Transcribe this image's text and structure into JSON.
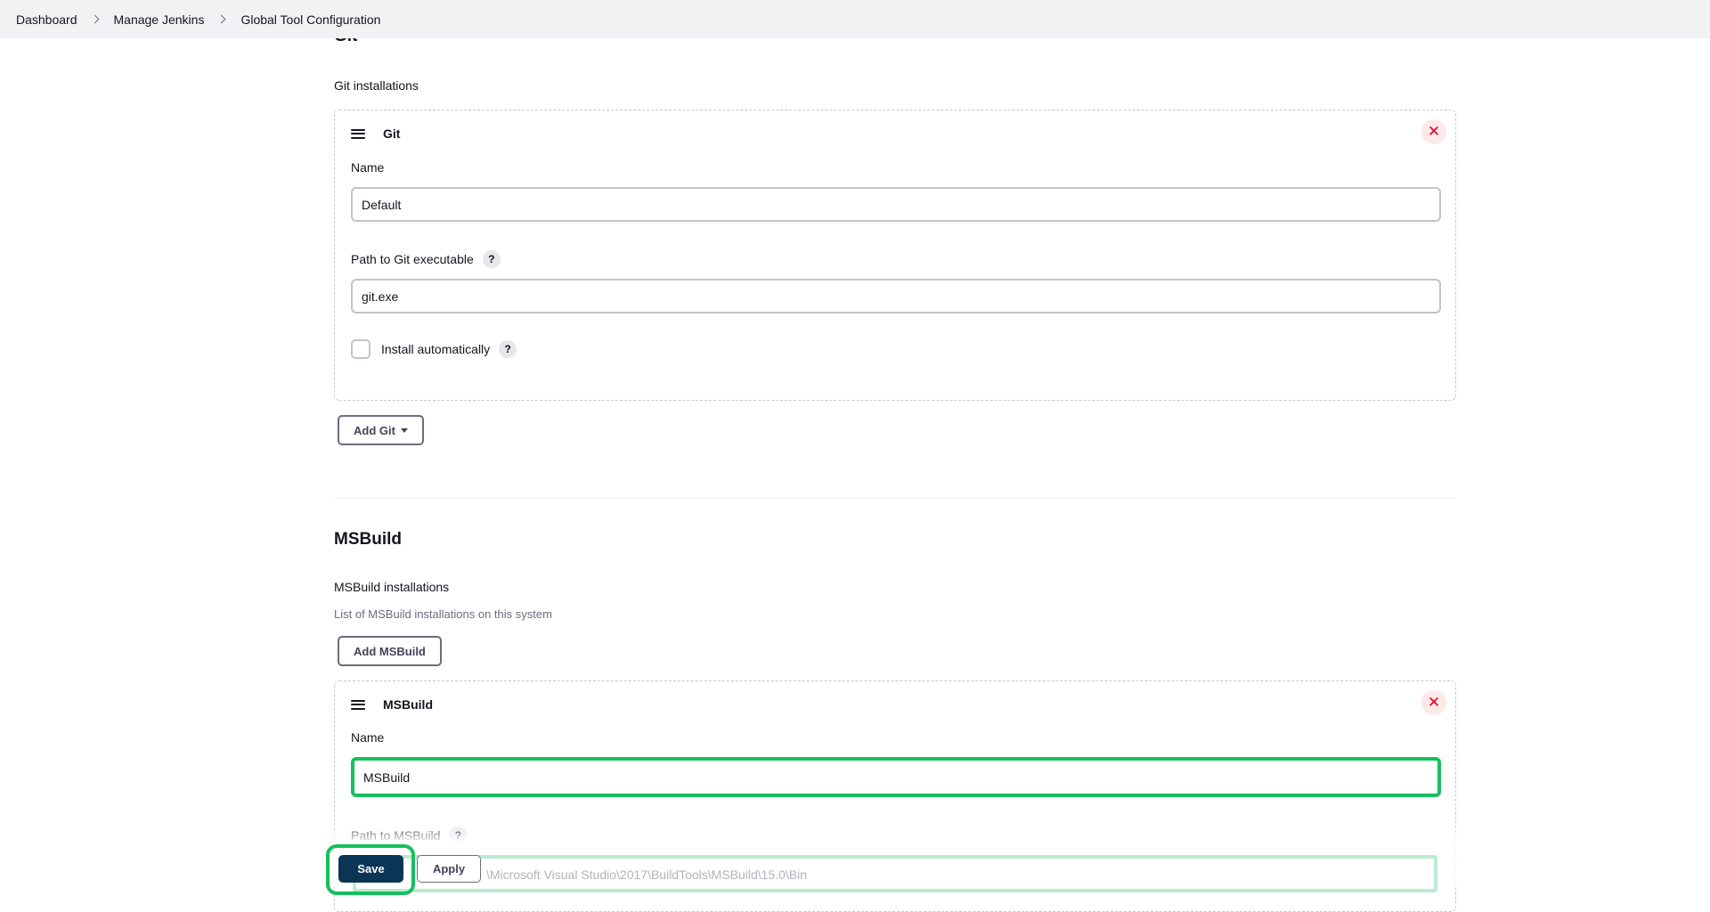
{
  "breadcrumb": {
    "items": [
      "Dashboard",
      "Manage Jenkins",
      "Global Tool Configuration"
    ]
  },
  "git": {
    "section_title": "Git",
    "installations_label": "Git installations",
    "item": {
      "title": "Git",
      "name_label": "Name",
      "name_value": "Default",
      "path_label": "Path to Git executable",
      "path_value": "git.exe",
      "install_auto_label": "Install automatically",
      "install_auto_checked": false
    },
    "add_button_label": "Add Git"
  },
  "msbuild": {
    "section_title": "MSBuild",
    "installations_label": "MSBuild installations",
    "description": "List of MSBuild installations on this system",
    "add_button_label": "Add MSBuild",
    "item": {
      "title": "MSBuild",
      "name_label": "Name",
      "name_value": "MSBuild",
      "path_label": "Path to MSBuild",
      "path_value": "\\Microsoft Visual Studio\\2017\\BuildTools\\MSBuild\\15.0\\Bin"
    }
  },
  "actions": {
    "save_label": "Save",
    "apply_label": "Apply"
  },
  "icons": {
    "help": "?",
    "delete": "✕"
  },
  "colors": {
    "highlight": "#15c05c",
    "save_bg": "#0b3556",
    "delete": "#e6001f"
  }
}
